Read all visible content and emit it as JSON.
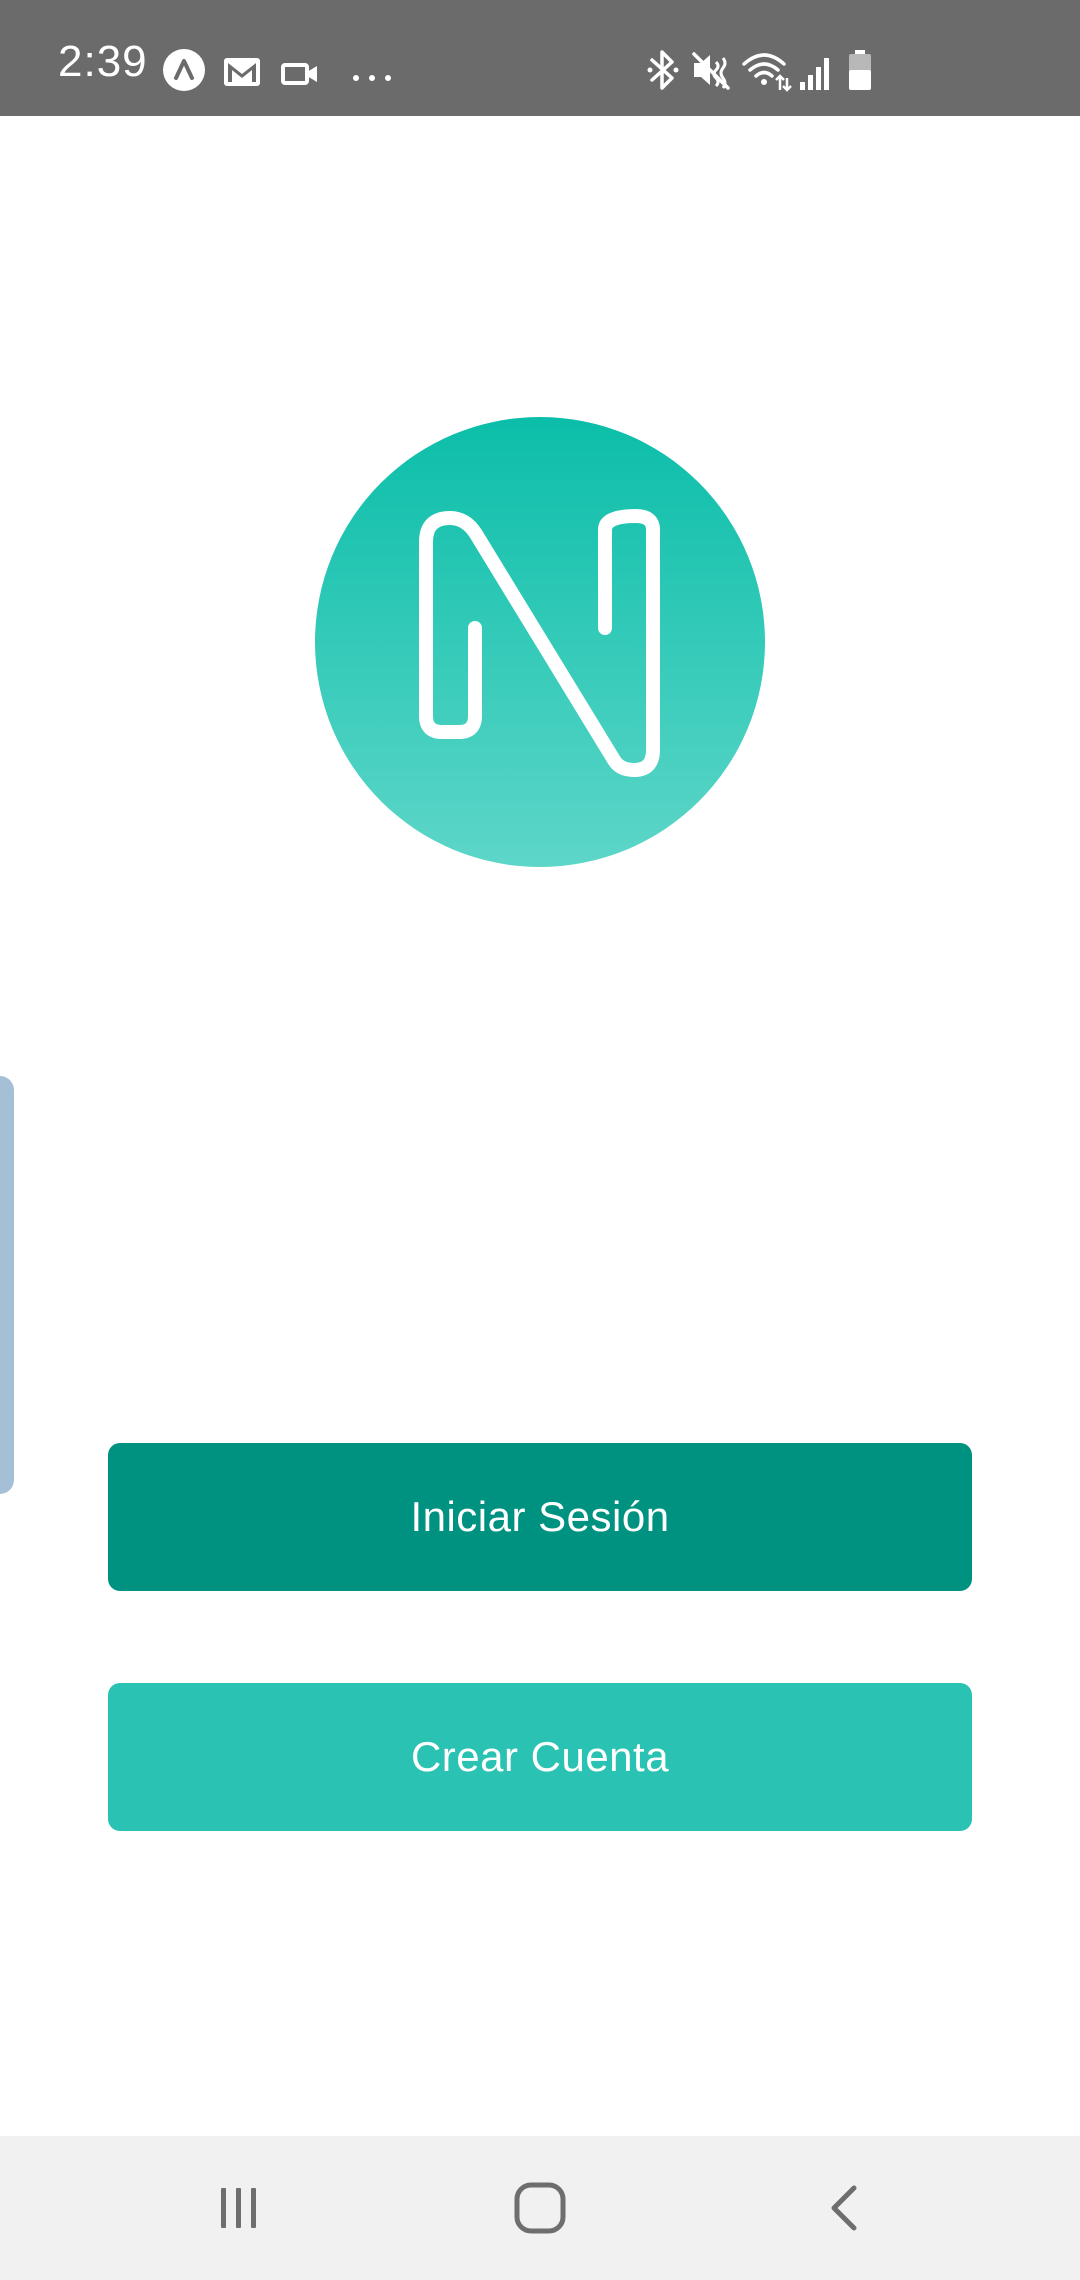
{
  "status_bar": {
    "time": "2:39",
    "icons": [
      "app-a-icon",
      "gmail-icon",
      "video-call-icon",
      "more-dots-icon",
      "bluetooth-icon",
      "mute-icon",
      "wifi-icon",
      "signal-icon",
      "battery-icon"
    ]
  },
  "logo": {
    "icon": "n-logo-icon",
    "gradient_top": "#0bbea9",
    "gradient_bottom": "#5dd6c8"
  },
  "actions": {
    "login_label": "Iniciar Sesión",
    "signup_label": "Crear Cuenta"
  },
  "colors": {
    "primary": "#009281",
    "secondary": "#2ac2b2",
    "status_bar": "#6b6b6b",
    "nav_bar": "#f1f1f1"
  },
  "navigation": {
    "icons": [
      "recent-apps-icon",
      "home-icon",
      "back-icon"
    ]
  }
}
